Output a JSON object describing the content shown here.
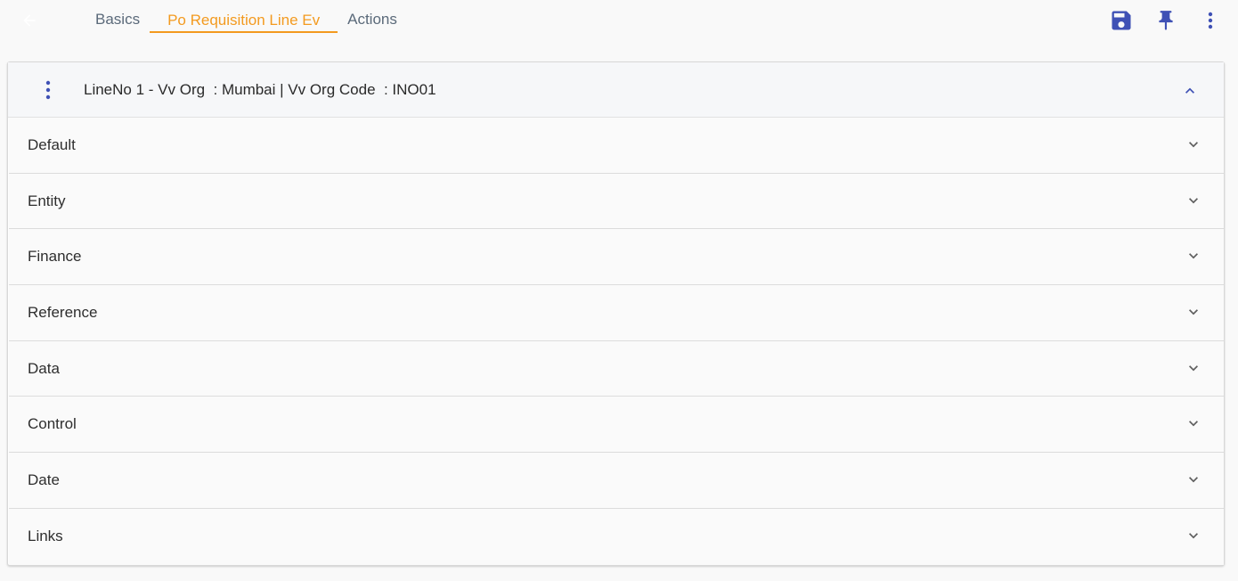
{
  "header": {
    "tabs": [
      {
        "label": "Basics",
        "active": false
      },
      {
        "label": "Po Requisition Line Ev",
        "active": true
      },
      {
        "label": "Actions",
        "active": false
      }
    ],
    "icons": [
      "arrow-left-icon",
      "save-icon",
      "pin-icon",
      "more-vertical-icon"
    ]
  },
  "panel": {
    "title": "LineNo 1 - Vv Org  : Mumbai | Vv Org Code  : INO01",
    "sections": [
      {
        "label": "Default"
      },
      {
        "label": "Entity"
      },
      {
        "label": "Finance"
      },
      {
        "label": "Reference"
      },
      {
        "label": "Data"
      },
      {
        "label": "Control"
      },
      {
        "label": "Date"
      },
      {
        "label": "Links"
      }
    ]
  },
  "colors": {
    "accent": "#f39a1f",
    "primary_icon": "#3f51b5",
    "tab_text": "#5b6a7a"
  }
}
